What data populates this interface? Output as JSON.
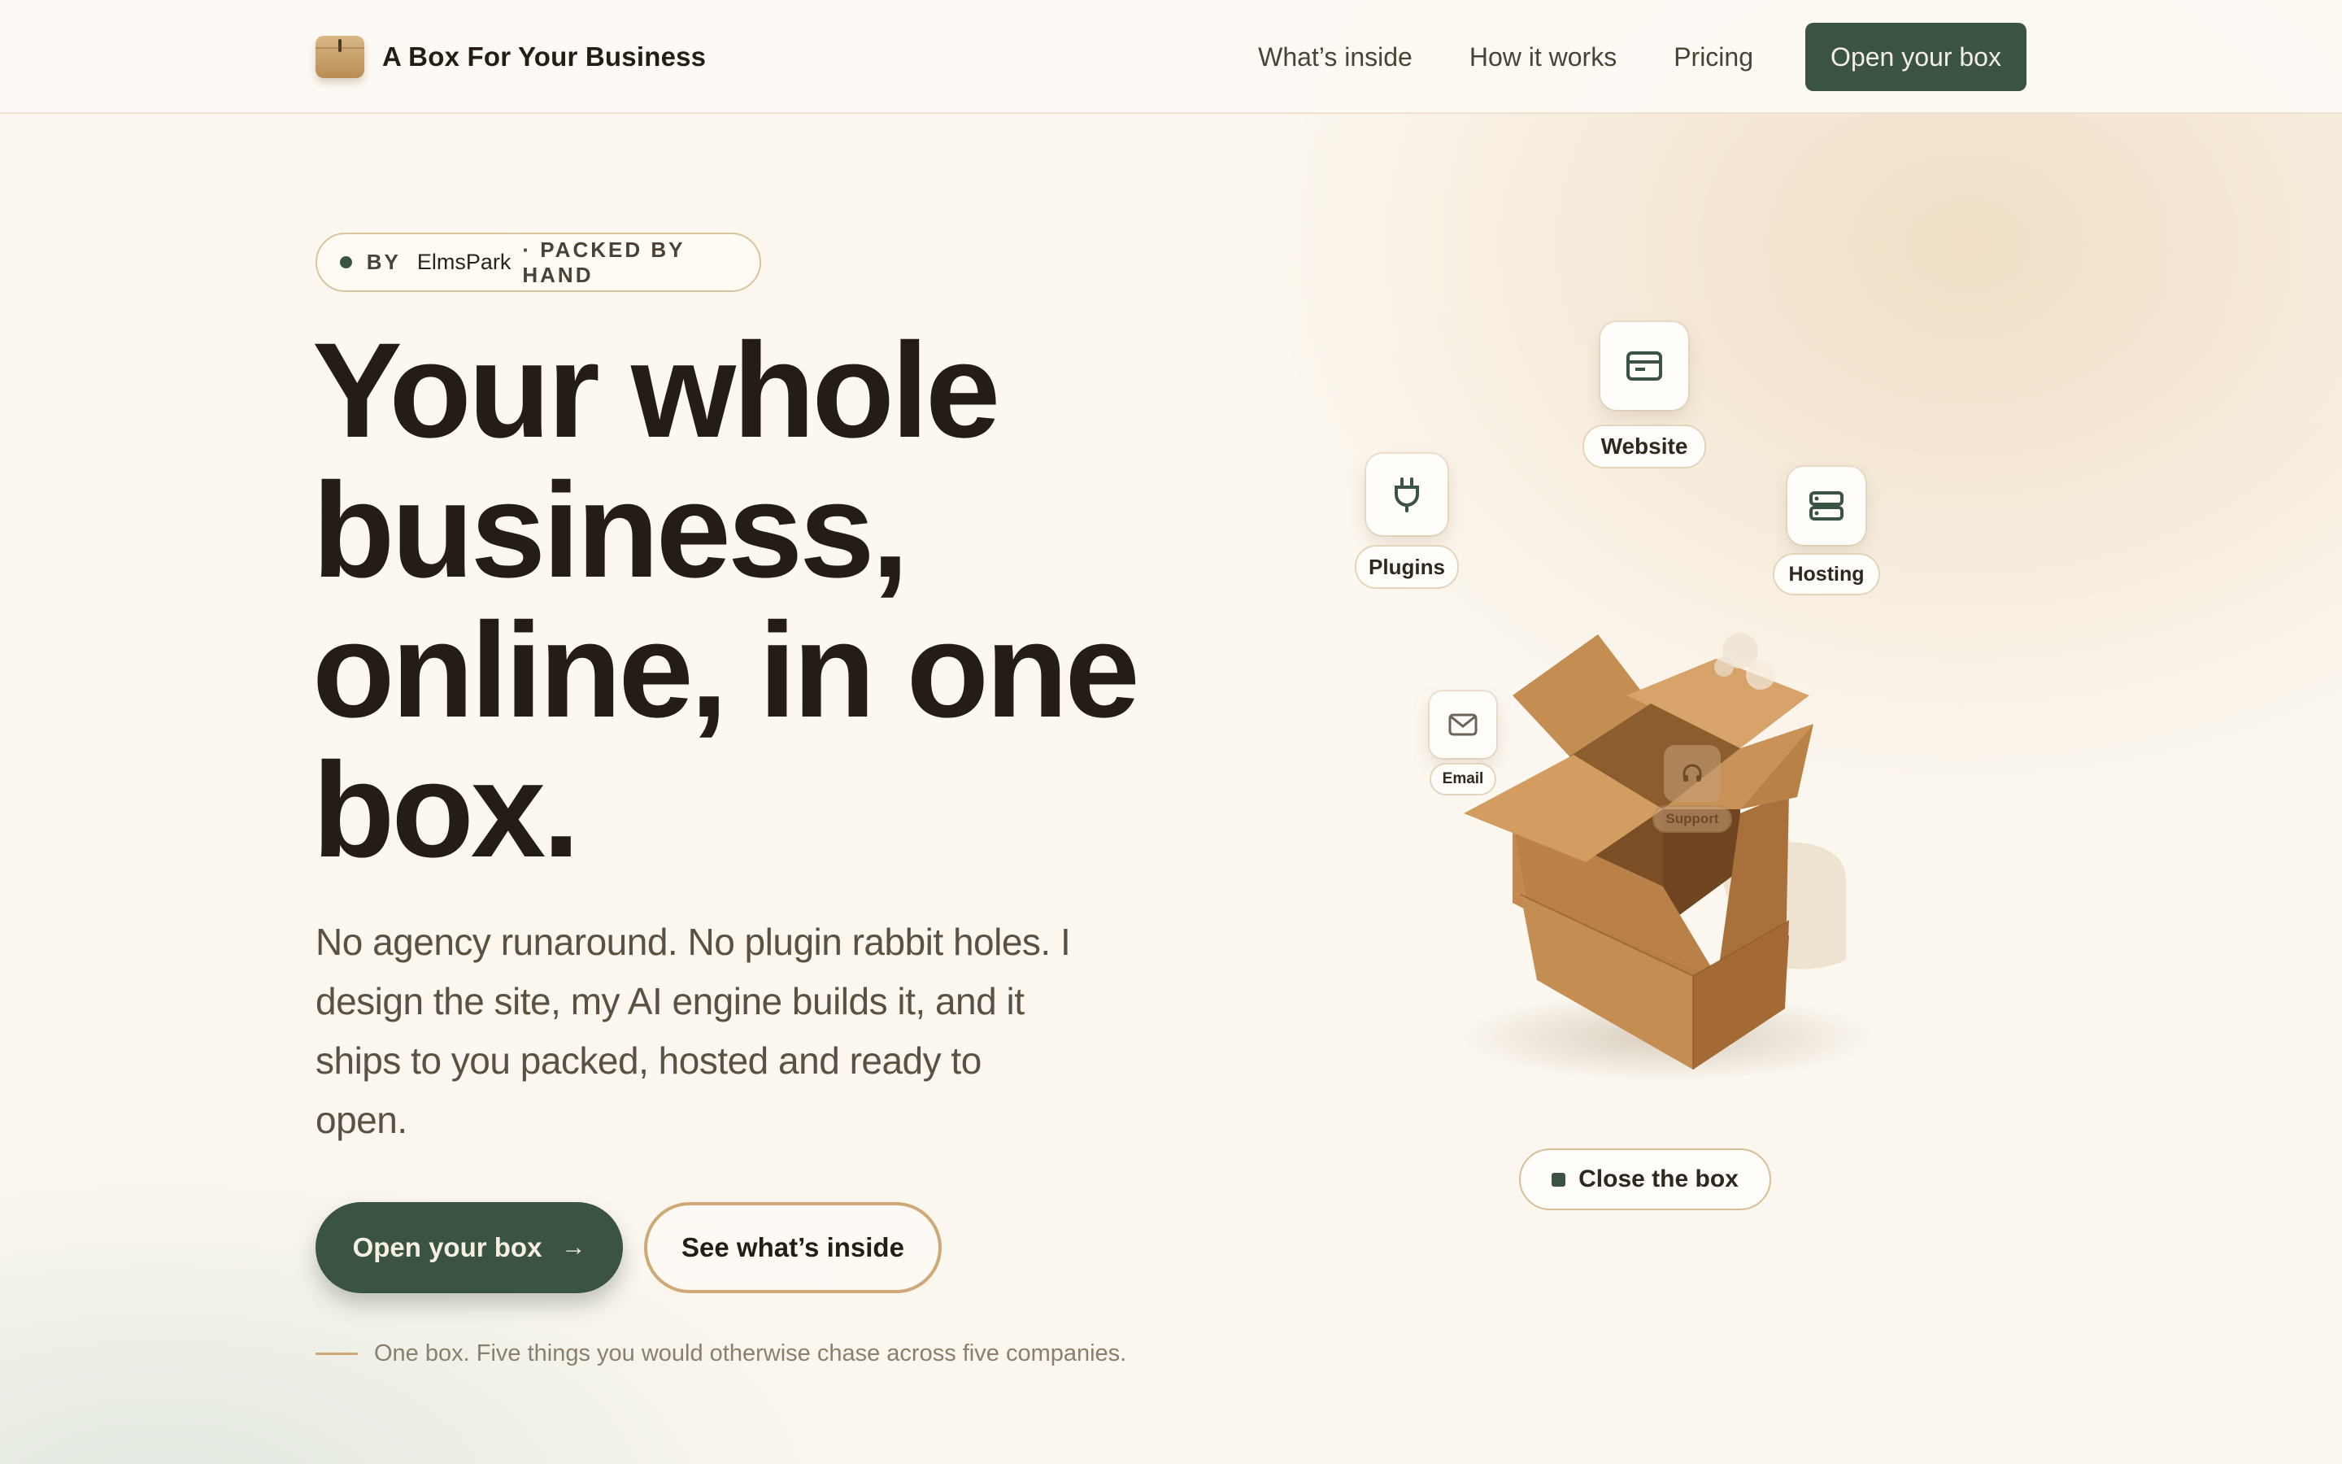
{
  "header": {
    "brand_name": "A Box For Your Business",
    "nav": [
      {
        "label": "What’s inside"
      },
      {
        "label": "How it works"
      },
      {
        "label": "Pricing"
      }
    ],
    "cta_label": "Open your box"
  },
  "hero": {
    "pill": {
      "prefix": "BY",
      "brand": "ElmsPark",
      "suffix": "· PACKED BY HAND"
    },
    "headline_lines": [
      "Your whole",
      "business,",
      "online, in one",
      "box."
    ],
    "subtext": "No agency runaround. No plugin rabbit holes. I design the site, my AI engine builds it, and it ships to you packed, hosted and ready to open.",
    "primary_button": "Open your box",
    "primary_arrow": "→",
    "secondary_button": "See what’s inside",
    "footnote": "One box. Five things you would otherwise chase across five companies."
  },
  "illustration": {
    "items": [
      {
        "label": "Website",
        "icon": "website-icon"
      },
      {
        "label": "Plugins",
        "icon": "plug-icon"
      },
      {
        "label": "Hosting",
        "icon": "server-icon"
      },
      {
        "label": "Email",
        "icon": "mail-icon"
      },
      {
        "label": "Support",
        "icon": "headphones-icon"
      }
    ],
    "close_button": "Close the box"
  },
  "colors": {
    "accent_green": "#3b5343",
    "accent_tan": "#cfa877",
    "cardboard": "#c48d52",
    "background": "#fcf8f1"
  }
}
